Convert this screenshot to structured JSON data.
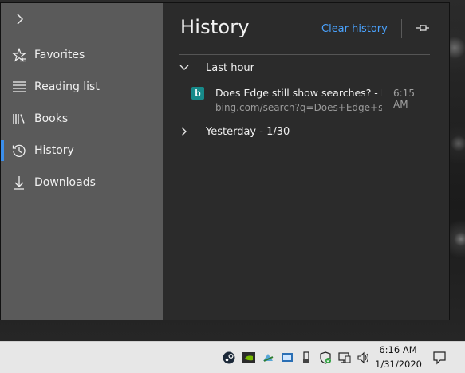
{
  "hub": {
    "nav": [
      {
        "label": "Favorites",
        "icon": "favorites-star-icon"
      },
      {
        "label": "Reading list",
        "icon": "reading-list-icon"
      },
      {
        "label": "Books",
        "icon": "books-icon"
      },
      {
        "label": "History",
        "icon": "history-clock-icon",
        "active": true
      },
      {
        "label": "Downloads",
        "icon": "download-arrow-icon"
      }
    ],
    "title": "History",
    "clear_label": "Clear history",
    "groups": [
      {
        "label": "Last hour",
        "expanded": true
      },
      {
        "label": "Yesterday - 1/30",
        "expanded": false
      }
    ],
    "entries": [
      {
        "title": "Does Edge still show searches? - Bing",
        "url": "bing.com/search?q=Does+Edge+still+show+searches",
        "time": "6:15 AM",
        "favicon_letter": "b"
      }
    ]
  },
  "taskbar": {
    "clock_time": "6:16 AM",
    "clock_date": "1/31/2020",
    "tray_icons": [
      "steam-icon",
      "nvidia-icon",
      "bluetooth-app-icon",
      "remote-desktop-icon",
      "usb-eject-icon",
      "defender-shield-icon",
      "network-icon",
      "volume-icon"
    ]
  },
  "colors": {
    "accent": "#3b8eea",
    "link": "#4aa3ff",
    "favicon": "#178a8a"
  }
}
